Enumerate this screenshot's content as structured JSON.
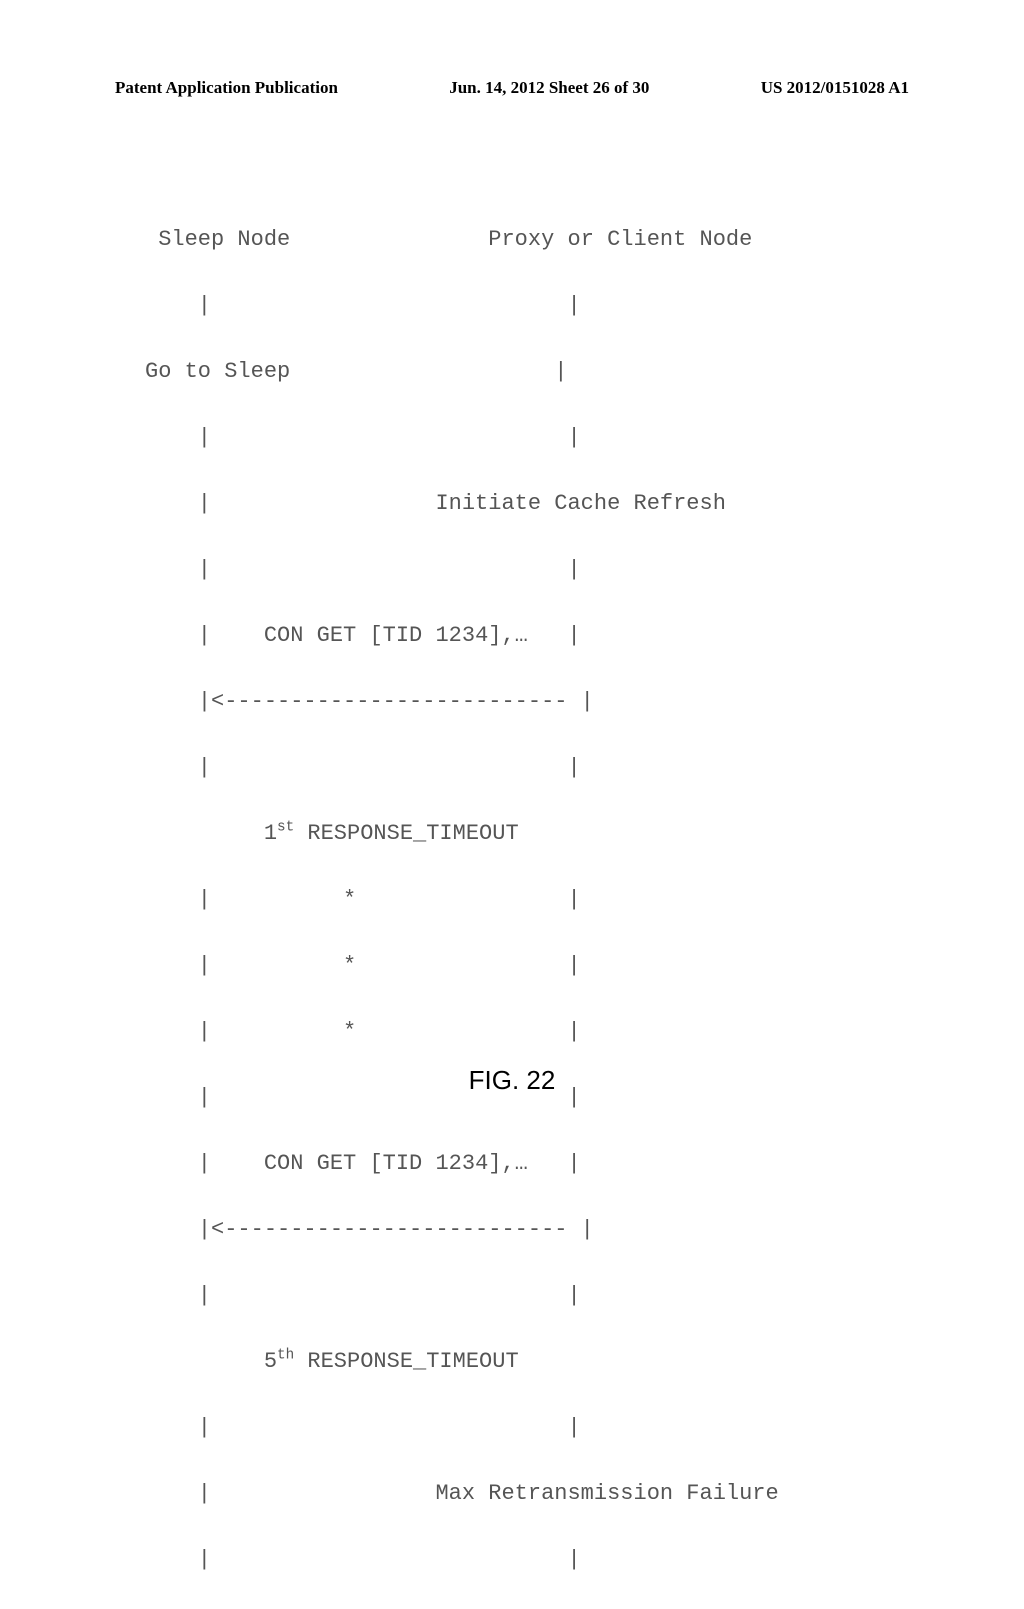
{
  "header": {
    "left": "Patent Application Publication",
    "center": "Jun. 14, 2012  Sheet 26 of 30",
    "right": "US 2012/0151028 A1"
  },
  "diagram": {
    "node_left": "Sleep Node",
    "node_right": "Proxy or Client Node",
    "go_to_sleep": "Go to Sleep",
    "initiate_cache": "Initiate Cache Refresh",
    "con_get_1": "CON GET [TID 1234],…",
    "arrow_left": "|<--------------------------",
    "first_ord": "st",
    "first_label": " RESPONSE_TIMEOUT",
    "con_get_2": "CON GET [TID 1234],…",
    "fifth_ord": "th",
    "fifth_label": " RESPONSE_TIMEOUT",
    "max_retrans": "Max Retransmission Failure"
  },
  "figure_label": "FIG. 22"
}
